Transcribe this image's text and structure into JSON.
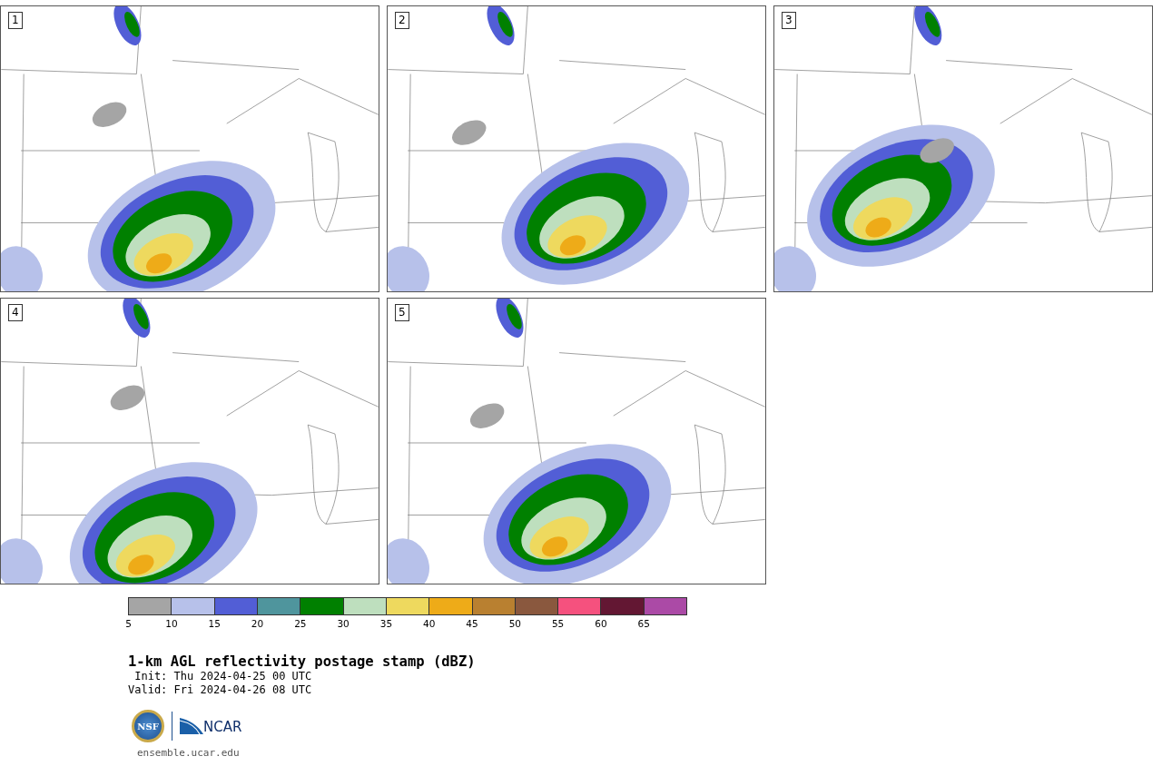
{
  "panels": [
    {
      "label": "1"
    },
    {
      "label": "2"
    },
    {
      "label": "3"
    },
    {
      "label": "4"
    },
    {
      "label": "5"
    }
  ],
  "colorbar": {
    "bins": [
      {
        "label": "5",
        "color": "#a5a5a5"
      },
      {
        "label": "10",
        "color": "#b7c1ea"
      },
      {
        "label": "15",
        "color": "#525ed6"
      },
      {
        "label": "20",
        "color": "#4f959d"
      },
      {
        "label": "25",
        "color": "#008000"
      },
      {
        "label": "30",
        "color": "#bedfbe"
      },
      {
        "label": "35",
        "color": "#eed95e"
      },
      {
        "label": "40",
        "color": "#eeab18"
      },
      {
        "label": "45",
        "color": "#b98030"
      },
      {
        "label": "50",
        "color": "#8a583e"
      },
      {
        "label": "55",
        "color": "#f5517e"
      },
      {
        "label": "60",
        "color": "#631733"
      },
      {
        "label": "65",
        "color": "#ab4aa6"
      }
    ]
  },
  "title": "1-km AGL reflectivity postage stamp (dBZ)",
  "init": " Init: Thu 2024-04-25 00 UTC",
  "valid": "Valid: Fri 2024-04-26 08 UTC",
  "logos": {
    "nsf": "NSF",
    "ncar": "NCAR"
  },
  "link": "ensemble.ucar.edu"
}
